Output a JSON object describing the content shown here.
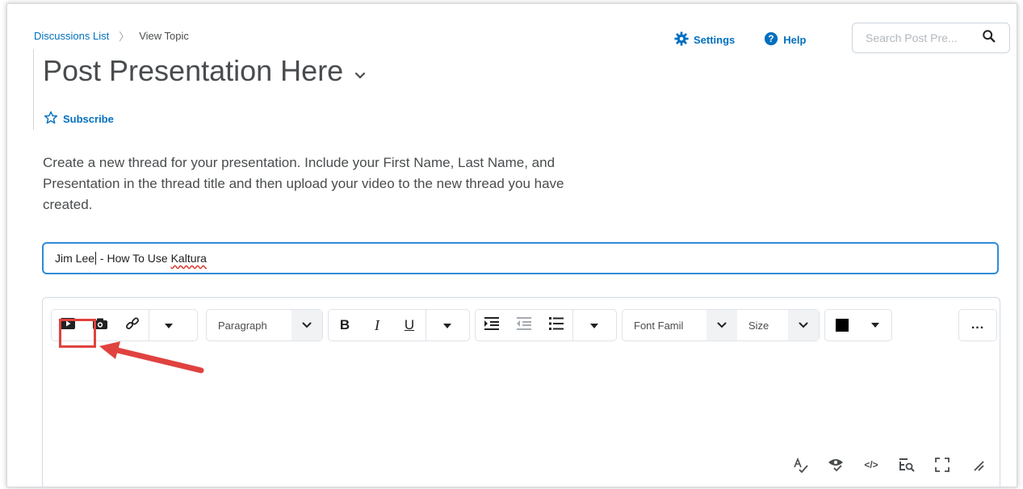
{
  "breadcrumb": {
    "link": "Discussions List",
    "separator": "〉",
    "current": "View Topic"
  },
  "topic": {
    "title": "Post Presentation Here"
  },
  "actions": {
    "settings": "Settings",
    "help": "Help"
  },
  "search": {
    "placeholder": "Search Post Pre..."
  },
  "subscribe": {
    "label": "Subscribe"
  },
  "description": "Create a new thread for your presentation. Include your First Name, Last Name, and Presentation in the thread title and then upload your video to the new thread you have created.",
  "thread_title": {
    "part1": "Jim Lee",
    "part2": " - How To Use ",
    "part3": "Kaltura"
  },
  "toolbar": {
    "block_format": "Paragraph",
    "bold": "B",
    "italic": "I",
    "underline": "U",
    "font_family": "Font Famil",
    "size": "Size",
    "more": "..."
  },
  "colors": {
    "accent": "#006fbf",
    "focus_border": "#2f8bd6",
    "highlight": "#e0423f",
    "text": "#494c4e"
  }
}
